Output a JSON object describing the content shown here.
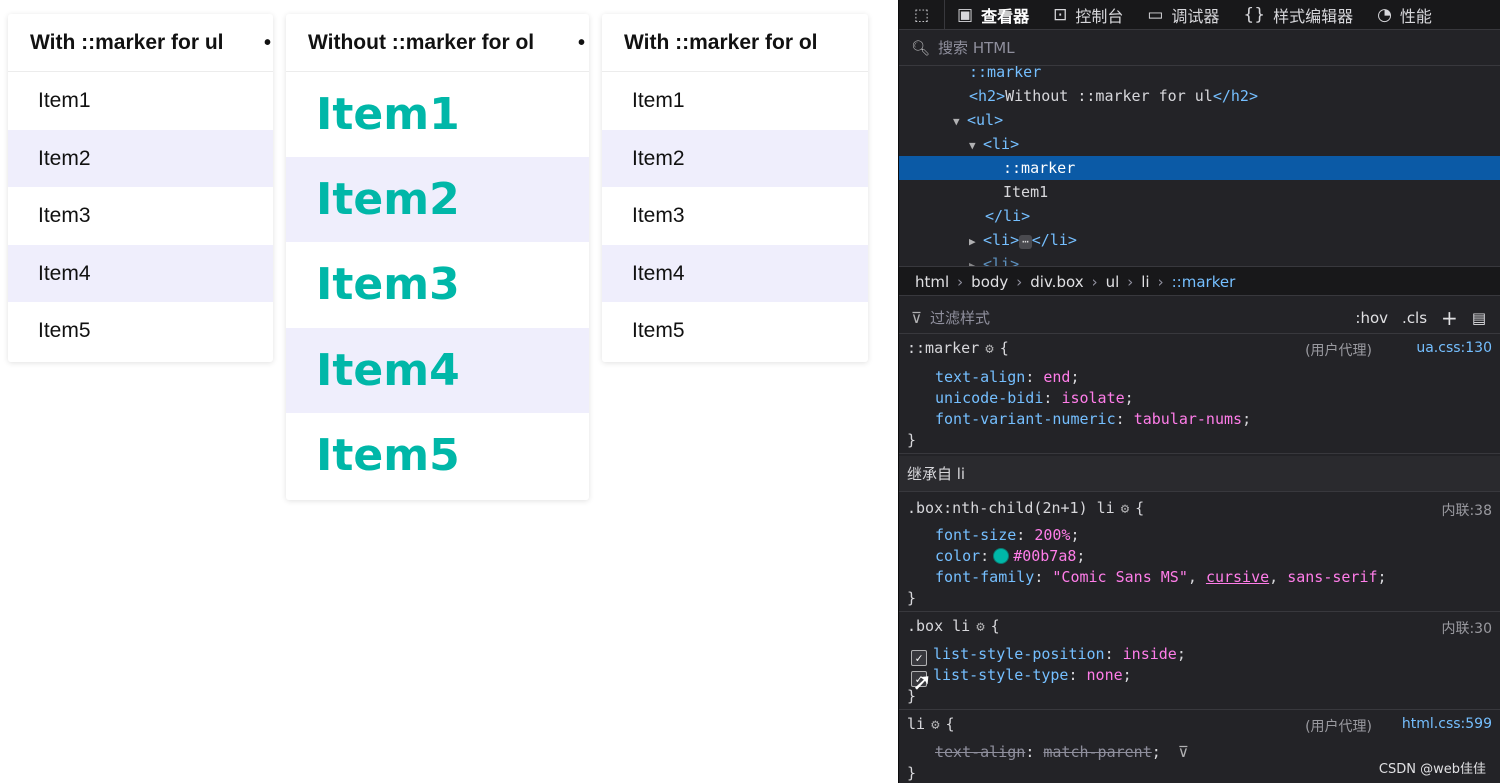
{
  "boxes": [
    {
      "title": "With ::marker for ul",
      "items": [
        "Item1",
        "Item2",
        "Item3",
        "Item4",
        "Item5"
      ]
    },
    {
      "title": "Without ::marker for ol",
      "items": [
        "Item1",
        "Item2",
        "Item3",
        "Item4",
        "Item5"
      ]
    },
    {
      "title": "With ::marker for ol",
      "items": [
        "Item1",
        "Item2",
        "Item3",
        "Item4",
        "Item5"
      ]
    }
  ],
  "box_item_colors": {
    "highlight": "#00b7a8",
    "stripe": "#efeefc"
  },
  "toolbar": {
    "tabs": [
      "查看器",
      "控制台",
      "调试器",
      "样式编辑器",
      "性能"
    ]
  },
  "search": {
    "placeholder": "搜索 HTML"
  },
  "markup": {
    "marker_cut": "::marker",
    "h2_line_open": "<h2>",
    "h2_text": "Without ::marker for ul",
    "h2_line_close": "</h2>",
    "ul_open": "<ul>",
    "li_open": "<li>",
    "marker_selected": "::marker",
    "li_text": "Item1",
    "li_close": "</li>",
    "li_collapsed_open": "<li>",
    "li_collapsed_close": "</li>",
    "ellipsis": "⋯"
  },
  "breadcrumbs": [
    "html",
    "body",
    "div.box",
    "ul",
    "li",
    "::marker"
  ],
  "filter": {
    "placeholder": "过滤样式",
    "hov": ":hov",
    "cls": ".cls",
    "add": "+"
  },
  "rules": {
    "marker": {
      "selector": "::marker",
      "source_origin": "(用户代理)",
      "source_file": "ua.css:130",
      "decls": [
        {
          "prop": "text-align",
          "value": "end"
        },
        {
          "prop": "unicode-bidi",
          "value": "isolate"
        },
        {
          "prop": "font-variant-numeric",
          "value": "tabular-nums"
        }
      ]
    },
    "inherited_label": "继承自 li",
    "nth": {
      "selector": ".box:nth-child(2n+1) li",
      "source": "内联:38",
      "font_size_prop": "font-size",
      "font_size_value": "200%",
      "color_prop": "color",
      "color_value": "#00b7a8",
      "font_family_prop": "font-family",
      "font_family_v1": "\"Comic Sans MS\"",
      "font_family_v2": "cursive",
      "font_family_v3": "sans-serif"
    },
    "boxli": {
      "selector": ".box li",
      "source": "内联:30",
      "decl1_prop": "list-style-position",
      "decl1_value": "inside",
      "decl2_prop": "list-style-type",
      "decl2_value": "none"
    },
    "li": {
      "selector": "li",
      "source_origin": "(用户代理)",
      "source_file": "html.css:599",
      "decl_prop": "text-align",
      "decl_value": "match-parent"
    }
  },
  "watermark": "CSDN @web佳佳"
}
